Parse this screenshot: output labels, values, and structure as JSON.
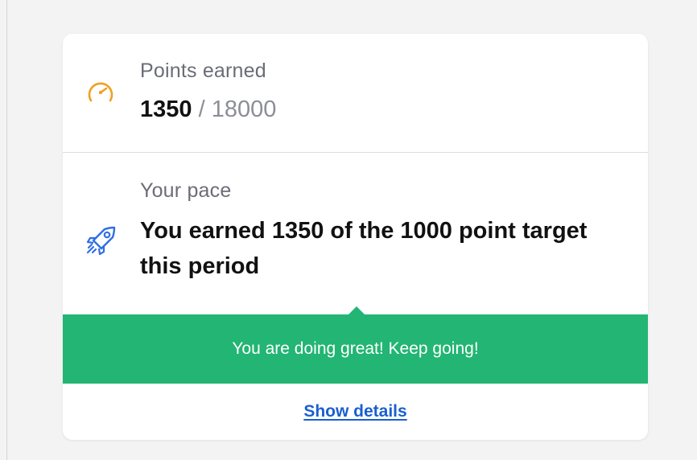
{
  "points": {
    "label": "Points earned",
    "earned": "1350",
    "separator": "/",
    "total": "18000",
    "icon": "gauge-icon"
  },
  "pace": {
    "label": "Your pace",
    "message": "You earned 1350 of the 1000 point target this period",
    "icon": "rocket-icon"
  },
  "banner": {
    "text": "You are doing great! Keep going!"
  },
  "footer": {
    "details_label": "Show details"
  },
  "colors": {
    "accent_orange": "#f0a020",
    "accent_blue": "#2f6fe4",
    "success_green": "#22b573",
    "link_blue": "#1a5fd0"
  }
}
